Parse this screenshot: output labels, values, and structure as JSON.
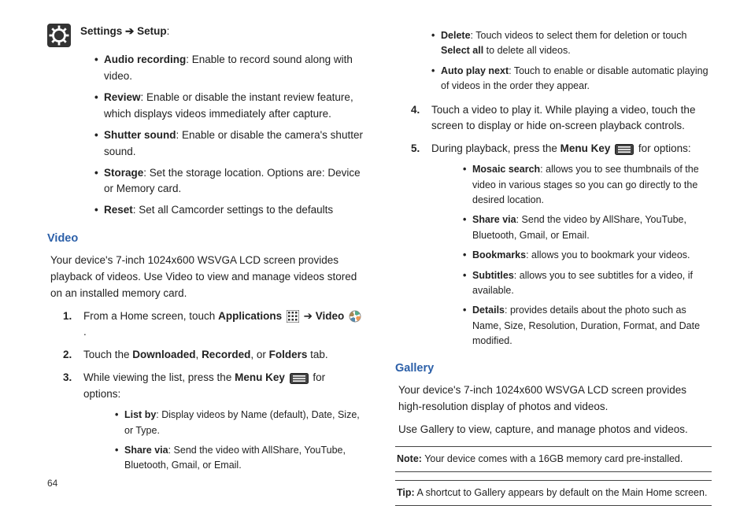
{
  "left": {
    "settings_path": {
      "a": "Settings",
      "arrow": "➔",
      "b": "Setup"
    },
    "settings_items": [
      {
        "t": "Audio recording",
        "d": ": Enable to record sound along with video."
      },
      {
        "t": "Review",
        "d": ": Enable or disable the instant review feature, which displays videos immediately after capture."
      },
      {
        "t": "Shutter sound",
        "d": ": Enable or disable the camera's shutter sound."
      },
      {
        "t": "Storage",
        "d": ": Set the storage location. Options are: Device or Memory card."
      },
      {
        "t": "Reset",
        "d": ": Set all Camcorder settings to the defaults"
      }
    ],
    "video_heading": "Video",
    "video_intro": "Your device's 7-inch 1024x600 WSVGA LCD screen provides playback of videos. Use Video to view and manage videos stored on an installed memory card.",
    "step1_a": "From a Home screen, touch ",
    "step1_b": "Applications",
    "step1_c": " ➔ ",
    "step1_d": "Video",
    "step1_e": " .",
    "step2_a": "Touch the ",
    "step2_b": "Downloaded",
    "step2_c": ", ",
    "step2_d": "Recorded",
    "step2_e": ", or ",
    "step2_f": "Folders",
    "step2_g": " tab.",
    "step3_a": "While viewing the list, press the ",
    "step3_b": "Menu Key",
    "step3_c": " for options:",
    "step3_items": [
      {
        "t": "List by",
        "d": ": Display videos by Name (default), Date, Size, or Type."
      },
      {
        "t": "Share via",
        "d": ": Send the video with AllShare, YouTube, Bluetooth, Gmail, or Email."
      }
    ]
  },
  "right": {
    "cont_items": [
      {
        "t": "Delete",
        "d": ": Touch videos to select them for deletion or touch ",
        "t2": "Select all",
        "d2": " to delete all videos."
      },
      {
        "t": "Auto play next",
        "d": ": Touch to enable or disable automatic playing of videos in the order they appear."
      }
    ],
    "step4": "Touch a video to play it. While playing a video, touch the screen to display or hide on-screen playback controls.",
    "step5_a": "During playback, press the ",
    "step5_b": "Menu Key",
    "step5_c": " for options:",
    "step5_items": [
      {
        "t": "Mosaic search",
        "d": ": allows you to see thumbnails of the video in various stages so you can go directly to the desired location."
      },
      {
        "t": "Share via",
        "d": ": Send the video by AllShare, YouTube, Bluetooth, Gmail, or Email."
      },
      {
        "t": "Bookmarks",
        "d": ": allows you to bookmark your videos."
      },
      {
        "t": "Subtitles",
        "d": ": allows you to see subtitles for a video, if available."
      },
      {
        "t": "Details",
        "d": ": provides details about the photo such as Name, Size, Resolution, Duration, Format, and Date modified."
      }
    ],
    "gallery_heading": "Gallery",
    "gallery_p1": "Your device's 7-inch 1024x600 WSVGA LCD screen provides high-resolution display of photos and videos.",
    "gallery_p2": "Use Gallery to view, capture, and manage photos and videos.",
    "note_label": "Note:",
    "note_text": " Your device comes with a 16GB memory card pre-installed.",
    "tip_label": "Tip:",
    "tip_text": " A shortcut to Gallery appears by default on the Main Home screen."
  },
  "page_number": "64"
}
